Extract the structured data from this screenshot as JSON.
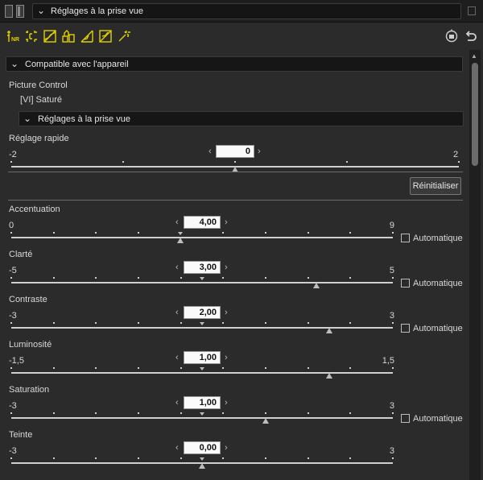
{
  "titlebar": {
    "dropdown_label": "Réglages à la prise vue"
  },
  "toolbar": {
    "icons": [
      "noise-reduction-icon",
      "crop-icon",
      "levels-icon",
      "color-icon",
      "curve-icon",
      "tone-icon",
      "magic-wand-icon"
    ],
    "right_icons": [
      "camera-reset-icon",
      "undo-icon"
    ],
    "accent": "#e0d000"
  },
  "panel": {
    "section_title": "Compatible avec l'appareil",
    "picture_control_label": "Picture Control",
    "picture_control_value": "[VI] Saturé",
    "subsection_title": "Réglages à la prise vue",
    "quick": {
      "label": "Réglage rapide",
      "value": "0",
      "min": "-2",
      "max": "2",
      "position": 0.5
    },
    "reset_button": "Réinitialiser",
    "auto_label": "Automatique",
    "sliders": [
      {
        "key": "accentuation",
        "label": "Accentuation",
        "value": "4,00",
        "min": "0",
        "max": "9",
        "position": 0.444,
        "default_position": 0.444,
        "auto": true
      },
      {
        "key": "clarte",
        "label": "Clarté",
        "value": "3,00",
        "min": "-5",
        "max": "5",
        "position": 0.8,
        "default_position": 0.5,
        "auto": true
      },
      {
        "key": "contraste",
        "label": "Contraste",
        "value": "2,00",
        "min": "-3",
        "max": "3",
        "position": 0.833,
        "default_position": 0.5,
        "auto": true
      },
      {
        "key": "luminosite",
        "label": "Luminosité",
        "value": "1,00",
        "min": "-1,5",
        "max": "1,5",
        "position": 0.833,
        "default_position": 0.5,
        "auto": false
      },
      {
        "key": "saturation",
        "label": "Saturation",
        "value": "1,00",
        "min": "-3",
        "max": "3",
        "position": 0.667,
        "default_position": 0.5,
        "auto": true
      },
      {
        "key": "teinte",
        "label": "Teinte",
        "value": "0,00",
        "min": "-3",
        "max": "3",
        "position": 0.5,
        "default_position": 0.5,
        "auto": false
      }
    ]
  }
}
